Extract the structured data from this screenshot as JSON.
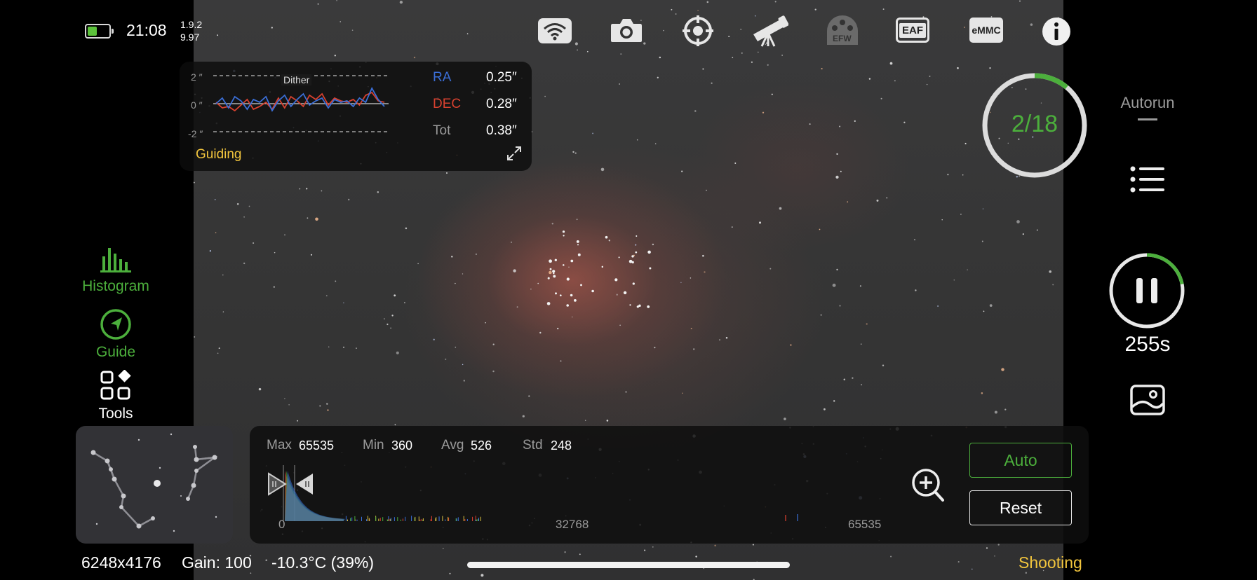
{
  "status": {
    "time": "21:08",
    "version_a": "1.9.2",
    "version_b": "9.97",
    "battery_color": "#5cc23b"
  },
  "top_icons": [
    "wifi-icon",
    "camera-icon",
    "crosshair-icon",
    "telescope-icon",
    "efw-icon",
    "eaf-icon",
    "emmc-icon",
    "info-icon"
  ],
  "top_labels": {
    "efw": "EFW",
    "eaf": "EAF",
    "emmc": "eMMC"
  },
  "guiding": {
    "title": "Guiding",
    "dither_label": "Dither",
    "y_ticks": [
      "2 ″",
      "0 ″",
      "-2 ″"
    ],
    "ra_label": "RA",
    "ra_value": "0.25″",
    "dec_label": "DEC",
    "dec_value": "0.28″",
    "tot_label": "Tot",
    "tot_value": "0.38″",
    "ra_color": "#3b6fd8",
    "dec_color": "#d8412f",
    "title_color": "#f2c53d",
    "ra_series": [
      0,
      0.4,
      -0.3,
      0.5,
      0.2,
      -0.4,
      0.3,
      0.1,
      0.5,
      -0.5,
      0.2,
      0.6,
      -0.2,
      0.3,
      0.7,
      -0.1,
      0.2,
      0.4,
      -0.3,
      0.3,
      0.1,
      0.2,
      -0.2,
      0.4,
      0.1,
      1.1,
      0.3,
      -0.2
    ],
    "dec_series": [
      0.1,
      -0.3,
      -0.2,
      -0.5,
      -0.1,
      0.3,
      -0.4,
      -0.2,
      0.1,
      -0.4,
      0.4,
      -0.3,
      0.5,
      0.2,
      -0.2,
      0.6,
      0.3,
      0.7,
      -0.1,
      0.4,
      0.2,
      0.1,
      0.3,
      -0.1,
      0.6,
      0.8,
      0.2,
      0.1
    ]
  },
  "progress": {
    "current": 2,
    "total": 18,
    "text": "2/18",
    "color": "#4caf3c"
  },
  "autorun": {
    "label": "Autorun"
  },
  "exposure": {
    "remaining": "255s",
    "progress": 0.22
  },
  "left_nav": [
    {
      "label": "Histogram",
      "icon": "histogram-icon",
      "color": "#4caf3c"
    },
    {
      "label": "Guide",
      "icon": "guide-compass-icon",
      "color": "#4caf3c"
    },
    {
      "label": "Tools",
      "icon": "tools-grid-icon",
      "color": "#ffffff"
    }
  ],
  "histogram": {
    "max_label": "Max",
    "max_value": "65535",
    "min_label": "Min",
    "min_value": "360",
    "avg_label": "Avg",
    "avg_value": "526",
    "std_label": "Std",
    "std_value": "248",
    "x_labels": [
      "0",
      "32768",
      "65535"
    ],
    "auto_label": "Auto",
    "reset_label": "Reset",
    "auto_color": "#4caf3c"
  },
  "footer": {
    "resolution": "6248x4176",
    "gain": "Gain: 100",
    "temperature": "-10.3°C (39%)",
    "state": "Shooting",
    "state_color": "#f2c53d"
  }
}
